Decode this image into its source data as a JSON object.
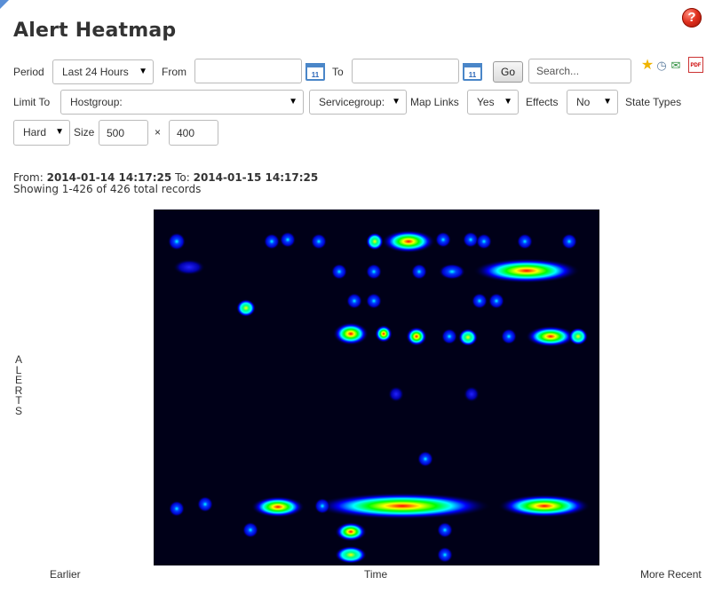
{
  "page": {
    "title": "Alert Heatmap",
    "help_icon": "question-help-icon"
  },
  "filters": {
    "period_label": "Period",
    "period_value": "Last 24 Hours",
    "from_label": "From",
    "from_value": "",
    "to_label": "To",
    "to_value": "",
    "calendar_text": "11",
    "go_label": "Go",
    "search_placeholder": "Search...",
    "limit_label": "Limit To",
    "hostgroup_value": "Hostgroup:",
    "servicegroup_value": "Servicegroup:",
    "maplinks_label": "Map Links",
    "maplinks_value": "Yes",
    "effects_label": "Effects",
    "effects_value": "No",
    "statetypes_label": "State Types",
    "statetypes_value": "Hard",
    "size_label": "Size",
    "width_value": "500",
    "size_sep": "×",
    "height_value": "400",
    "action_icons": [
      "star-icon",
      "clock-icon",
      "email-icon",
      "pdf-icon"
    ],
    "pdf_text": "PDF"
  },
  "report": {
    "from_prefix": "From:",
    "from_datetime": "2014-01-14 14:17:25",
    "to_prefix": "To:",
    "to_datetime": "2014-01-15 14:17:25",
    "records": "Showing 1-426 of 426 total records"
  },
  "heatmap": {
    "y_label": "ALERTS",
    "x_label": "Time",
    "x_left": "Earlier",
    "x_right": "More Recent",
    "colors": [
      "#000018",
      "#0000ff",
      "#00ffff",
      "#00ff00",
      "#ffff00",
      "#ff0000"
    ]
  }
}
